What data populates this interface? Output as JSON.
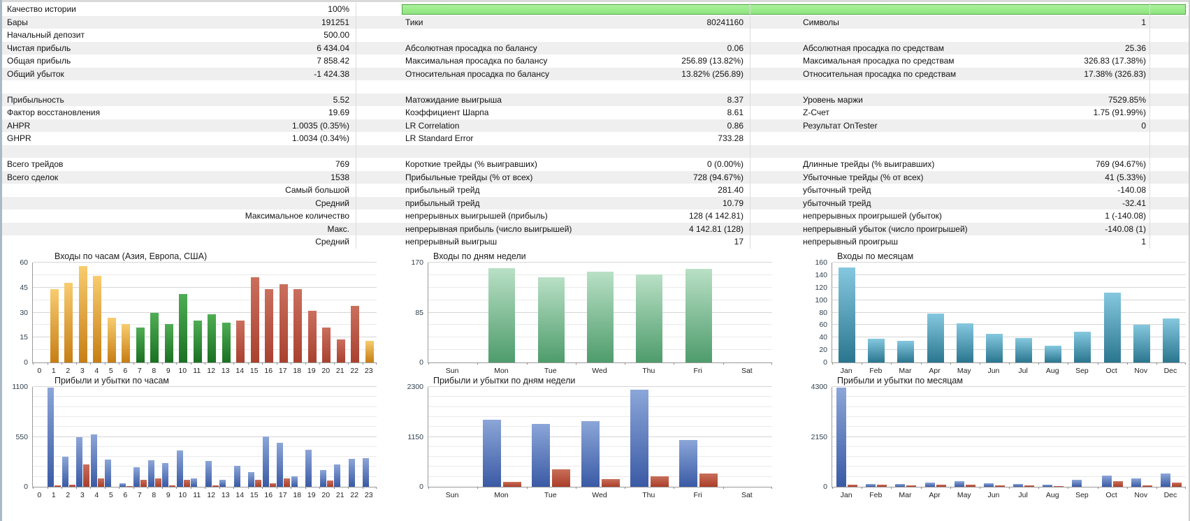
{
  "table": {
    "rows": [
      {
        "quality_row": true,
        "c1_label": "Качество истории",
        "c1_value": "100%"
      },
      {
        "c1_label": "Бары",
        "c1_value": "191251",
        "c2_label": "Тики",
        "c2_value": "80241160",
        "c3_label": "Символы",
        "c3_value": "1"
      },
      {
        "c1_label": "Начальный депозит",
        "c1_value": "500.00"
      },
      {
        "c1_label": "Чистая прибыль",
        "c1_value": "6 434.04",
        "c2_label": "Абсолютная просадка по балансу",
        "c2_value": "0.06",
        "c3_label": "Абсолютная просадка по средствам",
        "c3_value": "25.36"
      },
      {
        "c1_label": "Общая прибыль",
        "c1_value": "7 858.42",
        "c2_label": "Максимальная просадка по балансу",
        "c2_value": "256.89 (13.82%)",
        "c3_label": "Максимальная просадка по средствам",
        "c3_value": "326.83 (17.38%)"
      },
      {
        "c1_label": "Общий убыток",
        "c1_value": "-1 424.38",
        "c2_label": "Относительная просадка по балансу",
        "c2_value": "13.82% (256.89)",
        "c3_label": "Относительная просадка по средствам",
        "c3_value": "17.38% (326.83)"
      },
      {},
      {
        "c1_label": "Прибыльность",
        "c1_value": "5.52",
        "c2_label": "Матожидание выигрыша",
        "c2_value": "8.37",
        "c3_label": "Уровень маржи",
        "c3_value": "7529.85%"
      },
      {
        "c1_label": "Фактор восстановления",
        "c1_value": "19.69",
        "c2_label": "Коэффициент Шарпа",
        "c2_value": "8.61",
        "c3_label": "Z-Счет",
        "c3_value": "1.75 (91.99%)"
      },
      {
        "c1_label": "AHPR",
        "c1_value": "1.0035 (0.35%)",
        "c2_label": "LR Correlation",
        "c2_value": "0.86",
        "c3_label": "Результат OnTester",
        "c3_value": "0"
      },
      {
        "c1_label": "GHPR",
        "c1_value": "1.0034 (0.34%)",
        "c2_label": "LR Standard Error",
        "c2_value": "733.28"
      },
      {},
      {
        "c1_label": "Всего трейдов",
        "c1_value": "769",
        "c2_label": "Короткие трейды (% выигравших)",
        "c2_value": "0 (0.00%)",
        "c3_label": "Длинные трейды (% выигравших)",
        "c3_value": "769 (94.67%)"
      },
      {
        "c1_label": "Всего сделок",
        "c1_value": "1538",
        "c2_label": "Прибыльные трейды (% от всех)",
        "c2_value": "728 (94.67%)",
        "c3_label": "Убыточные трейды (% от всех)",
        "c3_value": "41 (5.33%)"
      },
      {
        "c1_value": "Самый большой",
        "c2_label": "прибыльный трейд",
        "c2_value": "281.40",
        "c3_label": "убыточный трейд",
        "c3_value": "-140.08"
      },
      {
        "c1_value": "Средний",
        "c2_label": "прибыльный трейд",
        "c2_value": "10.79",
        "c3_label": "убыточный трейд",
        "c3_value": "-32.41"
      },
      {
        "c1_value": "Максимальное количество",
        "c2_label": "непрерывных выигрышей (прибыль)",
        "c2_value": "128 (4 142.81)",
        "c3_label": "непрерывных проигрышей (убыток)",
        "c3_value": "1 (-140.08)"
      },
      {
        "c1_value": "Макс.",
        "c2_label": "непрерывная прибыль (число выигрышей)",
        "c2_value": "4 142.81 (128)",
        "c3_label": "непрерывный убыток (число проигрышей)",
        "c3_value": "-140.08 (1)"
      },
      {
        "c1_value": "Средний",
        "c2_label": "непрерывный выигрыш",
        "c2_value": "17",
        "c3_label": "непрерывный проигрыш",
        "c3_value": "1"
      }
    ],
    "stripe_color": "#efefef",
    "quality_bar_fill": "#99ec89",
    "quality_bar_border": "#55a44c"
  },
  "palettes": {
    "asia": [
      "#f8cc6f",
      "#c77e14"
    ],
    "europe": [
      "#4fad54",
      "#1a7122"
    ],
    "usa": [
      "#cb6f5d",
      "#a94130"
    ],
    "week_green": [
      "#b9e0c5",
      "#4e9c6c"
    ],
    "month_blue": [
      "#85c8df",
      "#2a768f"
    ],
    "profit_blue": [
      "#8ca6d8",
      "#3a5aa5"
    ],
    "loss_red": [
      "#c96f5a",
      "#aa3e2a"
    ]
  },
  "chart_data": [
    {
      "type": "bar",
      "title": "Входы по часам (Азия, Европа, США)",
      "categories": [
        "0",
        "1",
        "2",
        "3",
        "4",
        "5",
        "6",
        "7",
        "8",
        "9",
        "10",
        "11",
        "12",
        "13",
        "14",
        "15",
        "16",
        "17",
        "18",
        "19",
        "20",
        "21",
        "22",
        "23"
      ],
      "series": [
        {
          "name": "Входы",
          "values": [
            0,
            44,
            48,
            58,
            52,
            27,
            23,
            21,
            30,
            23,
            41,
            25,
            29,
            24,
            25,
            51,
            44,
            47,
            44,
            31,
            21,
            14,
            34,
            13
          ]
        }
      ],
      "bar_sessions": [
        "asia",
        "asia",
        "asia",
        "asia",
        "asia",
        "asia",
        "asia",
        "europe",
        "europe",
        "europe",
        "europe",
        "europe",
        "europe",
        "europe",
        "usa",
        "usa",
        "usa",
        "usa",
        "usa",
        "usa",
        "usa",
        "usa",
        "usa",
        "asia"
      ],
      "ylim": [
        0,
        60
      ],
      "yticks": [
        0,
        15,
        30,
        45,
        60
      ],
      "minor_step": 7.5
    },
    {
      "type": "bar",
      "title": "Входы по дням недели",
      "categories": [
        "Sun",
        "Mon",
        "Tue",
        "Wed",
        "Thu",
        "Fri",
        "Sat"
      ],
      "series": [
        {
          "name": "Входы",
          "values": [
            0,
            160,
            145,
            155,
            150,
            159,
            0
          ],
          "palette": "week_green"
        }
      ],
      "ylim": [
        0,
        170
      ],
      "yticks": [
        0,
        85,
        170
      ],
      "minor_step": 21.25
    },
    {
      "type": "bar",
      "title": "Входы по месяцам",
      "categories": [
        "Jan",
        "Feb",
        "Mar",
        "Apr",
        "May",
        "Jun",
        "Jul",
        "Aug",
        "Sep",
        "Oct",
        "Nov",
        "Dec"
      ],
      "series": [
        {
          "name": "Входы",
          "values": [
            152,
            38,
            35,
            78,
            63,
            46,
            39,
            27,
            49,
            112,
            60,
            70
          ],
          "palette": "month_blue"
        }
      ],
      "ylim": [
        0,
        160
      ],
      "yticks": [
        0,
        20,
        40,
        60,
        80,
        100,
        120,
        140,
        160
      ],
      "minor_step": 20
    },
    {
      "type": "bar",
      "title": "Прибыли и убытки по часам",
      "categories": [
        "0",
        "1",
        "2",
        "3",
        "4",
        "5",
        "6",
        "7",
        "8",
        "9",
        "10",
        "11",
        "12",
        "13",
        "14",
        "15",
        "16",
        "17",
        "18",
        "19",
        "20",
        "21",
        "22",
        "23"
      ],
      "series": [
        {
          "name": "прибыль",
          "values": [
            0,
            1090,
            330,
            550,
            575,
            300,
            40,
            215,
            290,
            265,
            400,
            90,
            285,
            75,
            230,
            165,
            555,
            485,
            115,
            410,
            185,
            250,
            305,
            315
          ],
          "palette": "profit_blue"
        },
        {
          "name": "убыток",
          "values": [
            0,
            15,
            25,
            245,
            95,
            0,
            10,
            75,
            90,
            15,
            80,
            0,
            15,
            0,
            0,
            75,
            35,
            90,
            0,
            0,
            70,
            0,
            0,
            0
          ],
          "palette": "loss_red"
        }
      ],
      "ylim": [
        0,
        1100
      ],
      "yticks": [
        0,
        550,
        1100
      ],
      "minor_step": 110
    },
    {
      "type": "bar",
      "title": "Прибыли и убытки по дням недели",
      "categories": [
        "Sun",
        "Mon",
        "Tue",
        "Wed",
        "Thu",
        "Fri",
        "Sat"
      ],
      "series": [
        {
          "name": "прибыль",
          "values": [
            0,
            1550,
            1450,
            1510,
            2230,
            1070,
            0
          ],
          "palette": "profit_blue"
        },
        {
          "name": "убыток",
          "values": [
            0,
            110,
            400,
            175,
            235,
            300,
            0
          ],
          "palette": "loss_red"
        }
      ],
      "ylim": [
        0,
        2300
      ],
      "yticks": [
        0,
        1150,
        2300
      ],
      "minor_step": 230
    },
    {
      "type": "bar",
      "title": "Прибыли и убытки по месяцам",
      "categories": [
        "Jan",
        "Feb",
        "Mar",
        "Apr",
        "May",
        "Jun",
        "Jul",
        "Aug",
        "Sep",
        "Oct",
        "Nov",
        "Dec"
      ],
      "series": [
        {
          "name": "прибыль",
          "values": [
            4280,
            120,
            130,
            190,
            230,
            160,
            130,
            90,
            310,
            480,
            370,
            560
          ],
          "palette": "profit_blue"
        },
        {
          "name": "убыток",
          "values": [
            100,
            80,
            60,
            90,
            80,
            60,
            50,
            30,
            0,
            250,
            50,
            190
          ],
          "palette": "loss_red"
        }
      ],
      "ylim": [
        0,
        4300
      ],
      "yticks": [
        0,
        2150,
        4300
      ],
      "minor_step": 430
    }
  ]
}
